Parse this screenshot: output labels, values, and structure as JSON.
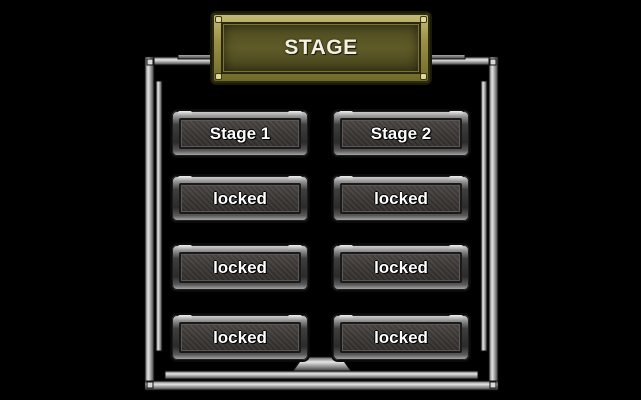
{
  "title": "STAGE",
  "stages": [
    {
      "label": "Stage 1",
      "state": "unlocked"
    },
    {
      "label": "Stage 2",
      "state": "unlocked"
    },
    {
      "label": "locked",
      "state": "locked"
    },
    {
      "label": "locked",
      "state": "locked"
    },
    {
      "label": "locked",
      "state": "locked"
    },
    {
      "label": "locked",
      "state": "locked"
    },
    {
      "label": "locked",
      "state": "locked"
    },
    {
      "label": "locked",
      "state": "locked"
    }
  ],
  "colors": {
    "background": "#000000",
    "title_plate": "#5f5b28",
    "button_face": "#3b3735",
    "text": "#ffffff"
  }
}
